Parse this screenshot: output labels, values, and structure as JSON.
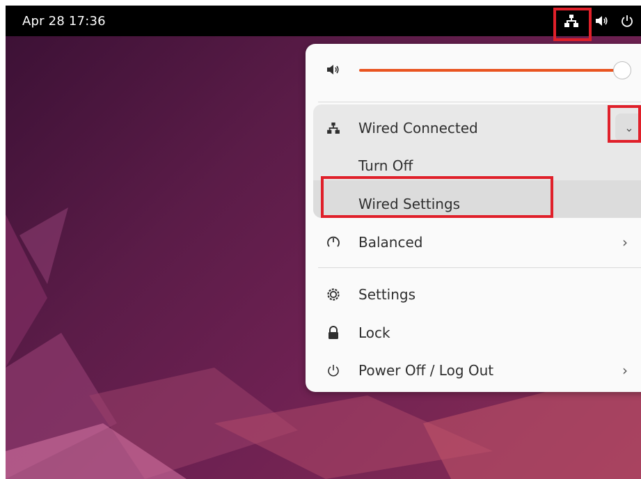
{
  "topbar": {
    "clock": "Apr 28  17:36",
    "tray_icons": [
      "network-wired-icon",
      "volume-icon",
      "power-icon"
    ]
  },
  "menu": {
    "volume": {
      "icon": "volume-icon",
      "level_fraction": 0.97
    },
    "wired": {
      "label": "Wired Connected",
      "icon": "network-wired-icon",
      "expanded": true
    },
    "wired_submenu": [
      {
        "label": "Turn Off"
      },
      {
        "label": "Wired Settings"
      }
    ],
    "power_mode": {
      "label": "Balanced",
      "icon": "power-mode-icon"
    },
    "settings": {
      "label": "Settings",
      "icon": "gear-icon"
    },
    "lock": {
      "label": "Lock",
      "icon": "lock-icon"
    },
    "power_off": {
      "label": "Power Off / Log Out",
      "icon": "power-icon"
    }
  },
  "colors": {
    "accent": "#e95420",
    "highlight_box": "#e0202a",
    "topbar": "#000000",
    "menu_bg": "#fafafa"
  }
}
